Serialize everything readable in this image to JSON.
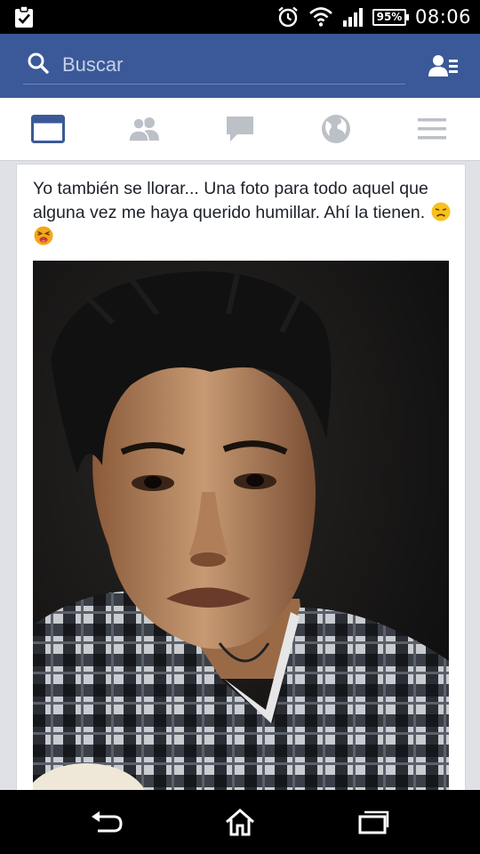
{
  "status_bar": {
    "time": "08:06",
    "battery": "95%",
    "icons": [
      "clipboard-check-icon",
      "alarm-icon",
      "wifi-icon",
      "signal-icon",
      "battery-icon"
    ]
  },
  "header": {
    "search_placeholder": "Buscar",
    "icons": [
      "search-icon",
      "friend-requests-icon"
    ],
    "brand_color": "#3b5998"
  },
  "tabs": [
    {
      "name": "news-feed",
      "icon": "news-feed-icon",
      "active": true
    },
    {
      "name": "friends",
      "icon": "friends-icon",
      "active": false
    },
    {
      "name": "messages",
      "icon": "chat-bubble-icon",
      "active": false
    },
    {
      "name": "notifications",
      "icon": "globe-icon",
      "active": false
    },
    {
      "name": "more",
      "icon": "hamburger-menu-icon",
      "active": false
    }
  ],
  "post": {
    "text": "Yo también se llorar... Una foto para todo aquel que alguna vez me haya querido humillar. Ahí la tienen.",
    "emojis": [
      "disappointed-face-emoji",
      "tired-face-emoji"
    ],
    "photo": "selfie of young man crying in checkered shirt"
  },
  "nav_bar": {
    "icons": [
      "back-icon",
      "home-icon",
      "recent-apps-icon"
    ]
  }
}
